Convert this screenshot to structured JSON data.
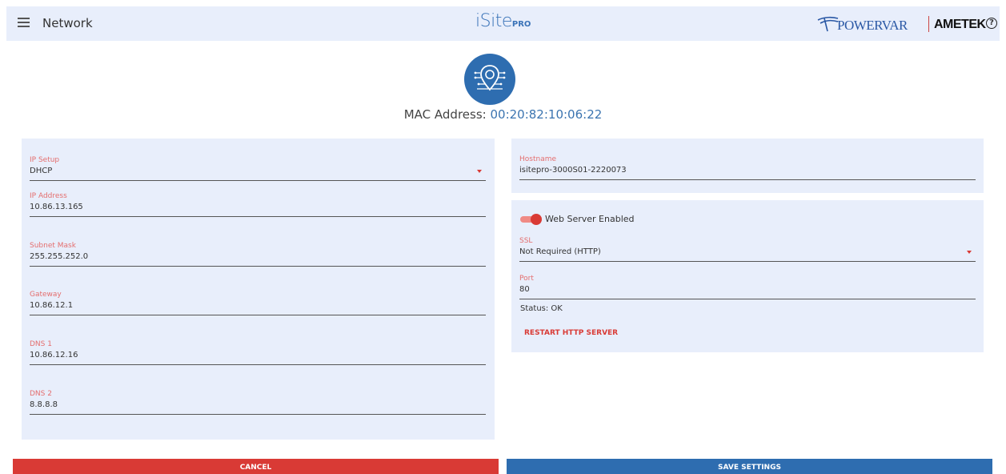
{
  "header": {
    "menu_icon": "hamburger-menu-icon",
    "title": "Network",
    "logo_main": "iSite",
    "logo_suffix": "PRO",
    "brand_powervar": "POWERVAR",
    "brand_ametek": "AMETEK",
    "help_symbol": "?"
  },
  "device": {
    "badge_icon": "network-location-icon",
    "mac_label": "MAC Address:",
    "mac_value": "00:20:82:10:06:22"
  },
  "ip_panel": {
    "ip_setup": {
      "label": "IP Setup",
      "value": "DHCP"
    },
    "ip_address": {
      "label": "IP Address",
      "value": "10.86.13.165"
    },
    "subnet_mask": {
      "label": "Subnet Mask",
      "value": "255.255.252.0"
    },
    "gateway": {
      "label": "Gateway",
      "value": "10.86.12.1"
    },
    "dns1": {
      "label": "DNS 1",
      "value": "10.86.12.16"
    },
    "dns2": {
      "label": "DNS 2",
      "value": "8.8.8.8"
    }
  },
  "hostname_panel": {
    "hostname": {
      "label": "Hostname",
      "value": "isitepro-3000S01-2220073"
    }
  },
  "web_panel": {
    "toggle_label": "Web Server Enabled",
    "toggle_on": true,
    "ssl": {
      "label": "SSL",
      "value": "Not Required (HTTP)"
    },
    "port": {
      "label": "Port",
      "value": "80"
    },
    "status": "Status: OK",
    "restart_label": "RESTART HTTP SERVER"
  },
  "actions": {
    "cancel_label": "CANCEL",
    "save_label": "SAVE SETTINGS"
  },
  "colors": {
    "accent_red": "#d93a35",
    "accent_blue": "#2e6db0",
    "panel_bg": "#e8eefb"
  }
}
